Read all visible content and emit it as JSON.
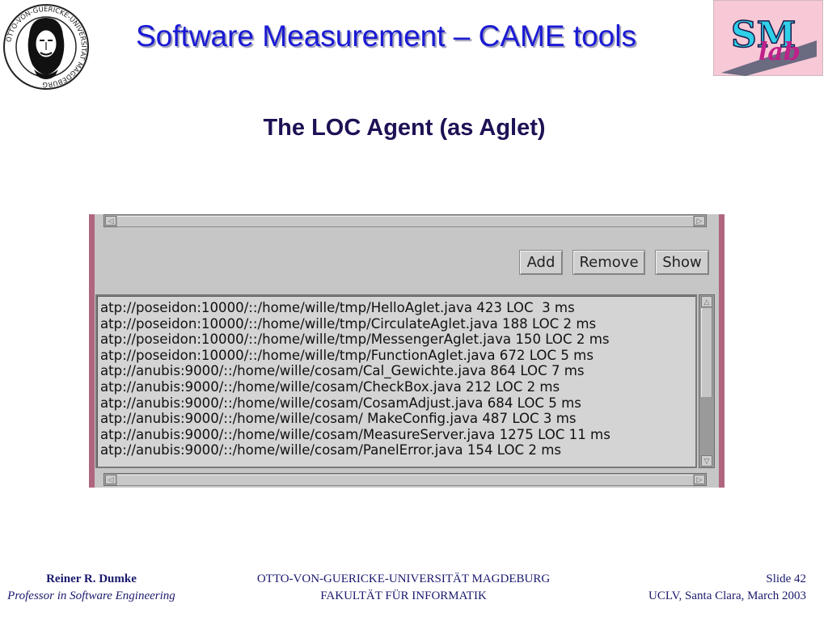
{
  "header": {
    "title": "Software Measurement – CAME tools",
    "seal_text": "OTTO-VON-GUERICKE-UNIVERSITÄT MAGDEBURG",
    "logo_text_top": "SM",
    "logo_text_bottom": "lab"
  },
  "subtitle": "The LOC Agent (as Aglet)",
  "aglet": {
    "buttons": {
      "add": "Add",
      "remove": "Remove",
      "show": "Show"
    },
    "lines": [
      "atp://poseidon:10000/::/home/wille/tmp/HelloAglet.java 423 LOC  3 ms",
      "atp://poseidon:10000/::/home/wille/tmp/CirculateAglet.java 188 LOC 2 ms",
      "atp://poseidon:10000/::/home/wille/tmp/MessengerAglet.java 150 LOC 2 ms",
      "atp://poseidon:10000/::/home/wille/tmp/FunctionAglet.java 672 LOC 5 ms",
      "atp://anubis:9000/::/home/wille/cosam/Cal_Gewichte.java 864 LOC 7 ms",
      "atp://anubis:9000/::/home/wille/cosam/CheckBox.java 212 LOC 2 ms",
      "atp://anubis:9000/::/home/wille/cosam/CosamAdjust.java 684 LOC 5 ms",
      "atp://anubis:9000/::/home/wille/cosam/ MakeConfig.java 487 LOC 3 ms",
      "atp://anubis:9000/::/home/wille/cosam/MeasureServer.java 1275 LOC 11 ms",
      "atp://anubis:9000/::/home/wille/cosam/PanelError.java 154 LOC 2 ms"
    ]
  },
  "footer": {
    "author": "Reiner R. Dumke",
    "author_role": "Professor in Software Engineering",
    "university": "OTTO-VON-GUERICKE-UNIVERSITÄT MAGDEBURG",
    "faculty": "FAKULTÄT FÜR INFORMATIK",
    "slide": "Slide 42",
    "event": "UCLV, Santa Clara, March 2003"
  },
  "colors": {
    "title": "#1a1ad4",
    "subtitle": "#1f1155",
    "window_bg": "#c6c6c6",
    "window_edge": "#b0657e",
    "logo_bg": "#f7c8d6",
    "logo_sm": "#2fd0e8",
    "logo_lab": "#c0208a"
  }
}
